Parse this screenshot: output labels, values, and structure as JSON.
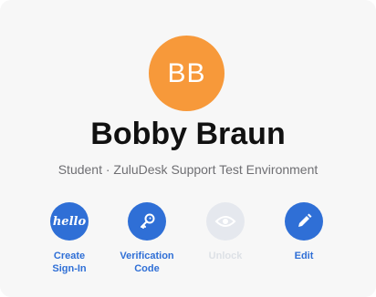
{
  "colors": {
    "accent": "#2f6fd6",
    "avatar_bg": "#f7993a",
    "disabled_circle": "#e5e8ee"
  },
  "profile": {
    "initials": "BB",
    "name": "Bobby Braun",
    "subtitle": "Student · ZuluDesk Support Test Environment"
  },
  "actions": [
    {
      "icon": "hello-icon",
      "glyph": "hello",
      "label_lines": [
        "Create",
        "Sign-In"
      ],
      "enabled": true
    },
    {
      "icon": "key-icon",
      "label_lines": [
        "Verification",
        "Code"
      ],
      "enabled": true
    },
    {
      "icon": "eye-icon",
      "label_lines": [
        "Unlock"
      ],
      "enabled": false
    },
    {
      "icon": "pencil-icon",
      "label_lines": [
        "Edit"
      ],
      "enabled": true
    }
  ]
}
